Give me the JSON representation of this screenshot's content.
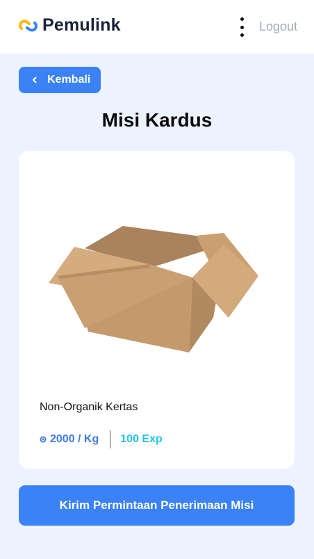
{
  "header": {
    "brand": "Pemulink",
    "logo_icon": "chain-link-icon",
    "menu_icon": "kebab-menu-icon",
    "logout_label": "Logout"
  },
  "back_button": {
    "label": "Kembali",
    "icon": "chevron-left-icon"
  },
  "page": {
    "title": "Misi Kardus"
  },
  "mission_card": {
    "image": "cardboard-box",
    "category": "Non-Organik Kertas",
    "price": "2000 / Kg",
    "price_icon": "coin-icon",
    "exp": "100 Exp"
  },
  "submit_button": {
    "label": "Kirim Permintaan Penerimaan Misi"
  },
  "colors": {
    "primary": "#3b82f6",
    "background": "#edf3fe",
    "price": "#3b7ae8",
    "exp": "#22c3e6",
    "logo_blue": "#3b82f6",
    "logo_yellow": "#f5b914"
  }
}
